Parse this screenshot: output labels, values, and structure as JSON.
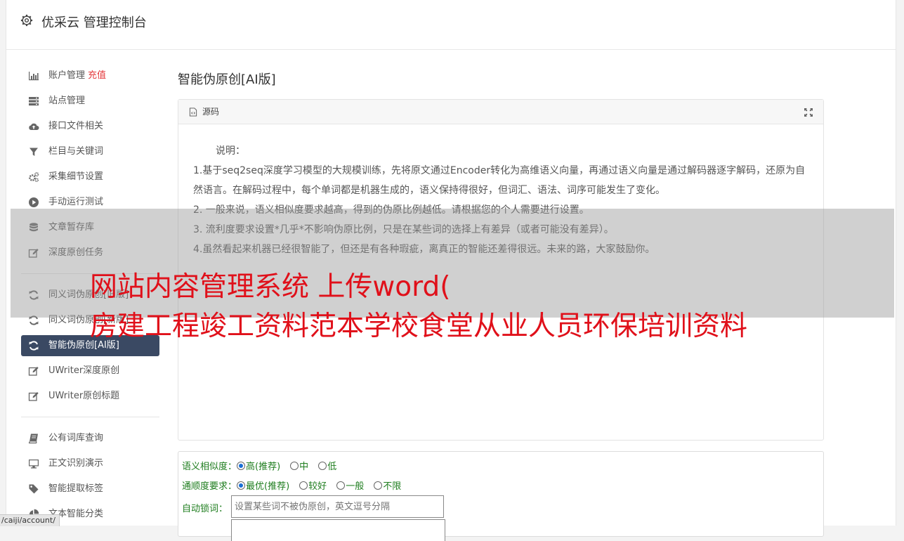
{
  "header": {
    "title": "优采云 管理控制台"
  },
  "sidebar": {
    "group1": [
      {
        "label": "账户管理",
        "extra": "充值",
        "icon": "bar-chart-icon"
      },
      {
        "label": "站点管理",
        "icon": "server-icon"
      },
      {
        "label": "接口文件相关",
        "icon": "cloud-upload-icon"
      },
      {
        "label": "栏目与关键词",
        "icon": "filter-icon"
      },
      {
        "label": "采集细节设置",
        "icon": "cogs-icon"
      },
      {
        "label": "手动运行测试",
        "icon": "play-circle-icon"
      },
      {
        "label": "文章暂存库",
        "icon": "database-icon"
      },
      {
        "label": "深度原创任务",
        "icon": "edit-icon"
      }
    ],
    "group2": [
      {
        "label": "同义词伪原创[旧版]",
        "icon": "refresh-icon"
      },
      {
        "label": "同义词伪原创[新版]",
        "icon": "refresh-icon"
      },
      {
        "label": "智能伪原创[AI版]",
        "icon": "refresh-icon",
        "active": true
      },
      {
        "label": "UWriter深度原创",
        "icon": "edit-icon"
      },
      {
        "label": "UWriter原创标题",
        "icon": "edit-icon"
      }
    ],
    "group3": [
      {
        "label": "公有词库查询",
        "icon": "book-icon"
      },
      {
        "label": "正文识别演示",
        "icon": "desktop-icon"
      },
      {
        "label": "智能提取标签",
        "icon": "tag-icon"
      },
      {
        "label": "文本智能分类",
        "icon": "pie-chart-icon"
      }
    ]
  },
  "main": {
    "title": "智能伪原创[AI版]",
    "panel": {
      "head": "源码",
      "intro": "说明：",
      "lines": [
        "1.基于seq2seq深度学习模型的大规模训练，先将原文通过Encoder转化为高维语义向量，再通过语义向量是通过解码器逐字解码，还原为自然语言。在解码过程中，每个单词都是机器生成的，语义保持得很好，但词汇、语法、词序可能发生了变化。",
        "2. 一般来说，语义相似度要求越高，得到的伪原比例越低。请根据您的个人需要进行设置。",
        "3. 流利度要求设置*几乎*不影响伪原比例，只是在某些词的选择上有差异（或者可能没有差异）。",
        "4.虽然看起来机器已经很智能了，但还是有各种瑕疵，离真正的智能还差得很远。未来的路，大家鼓励你。"
      ]
    },
    "form": {
      "similarity_label": "语义相似度：",
      "similarity_options": [
        "高(推荐)",
        "中",
        "低"
      ],
      "fluency_label": "通顺度要求：",
      "fluency_options": [
        "最优(推荐)",
        "较好",
        "一般",
        "不限"
      ],
      "lock_label": "自动锁词：",
      "lock_placeholder": "设置某些词不被伪原创，英文逗号分隔"
    }
  },
  "watermark": {
    "line1": "网站内容管理系统 上传word(",
    "line2": "房建工程竣工资料范本学校食堂从业人员环保培训资料"
  },
  "status_url": "/caiji/account/",
  "colors": {
    "sidebar_active": "#3a4963",
    "watermark": "#e0101a",
    "form_label": "#1e7d1e"
  }
}
